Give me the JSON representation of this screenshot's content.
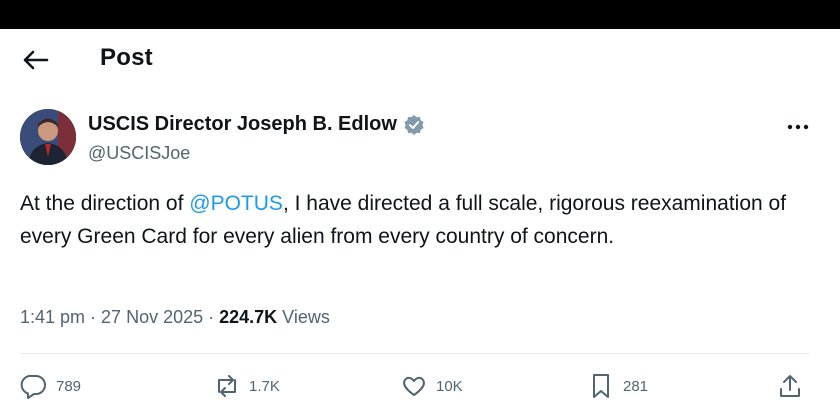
{
  "header": {
    "title": "Post"
  },
  "author": {
    "name": "USCIS Director Joseph B. Edlow",
    "handle": "@USCISJoe"
  },
  "post": {
    "text_before": "At the direction of ",
    "mention": "@POTUS",
    "text_after": ", I have directed a full scale, rigorous reexamination of every Green Card for every alien from every country of concern."
  },
  "meta": {
    "time": "1:41 pm",
    "sep1": " · ",
    "date": "27 Nov 2025",
    "sep2": " · ",
    "views_count": "224.7K",
    "views_label": " Views"
  },
  "actions": {
    "replies": "789",
    "reposts": "1.7K",
    "likes": "10K",
    "bookmarks": "281"
  },
  "colors": {
    "link": "#1d9bf0",
    "muted": "#536471",
    "text": "#0f1419",
    "verified": "#829aab"
  },
  "icons": [
    "back-arrow-icon",
    "verified-badge-icon",
    "more-icon",
    "reply-icon",
    "repost-icon",
    "like-icon",
    "bookmark-icon",
    "share-icon"
  ]
}
